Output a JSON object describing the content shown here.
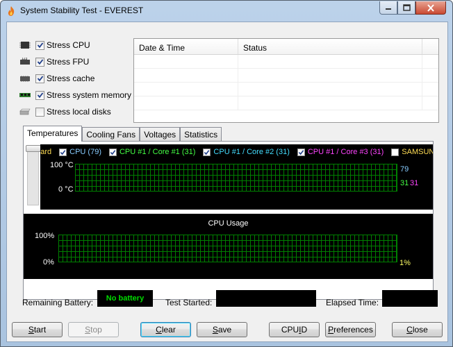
{
  "window": {
    "title": "System Stability Test - EVEREST",
    "min_glyph": "—",
    "max_glyph": "☐",
    "close_glyph": "✕"
  },
  "stress": [
    {
      "label": "Stress CPU",
      "checked": true,
      "icon": "cpu-chip-icon"
    },
    {
      "label": "Stress FPU",
      "checked": true,
      "icon": "fpu-chip-icon"
    },
    {
      "label": "Stress cache",
      "checked": true,
      "icon": "cache-chip-icon"
    },
    {
      "label": "Stress system memory",
      "checked": true,
      "icon": "memory-module-icon"
    },
    {
      "label": "Stress local disks",
      "checked": false,
      "icon": "hard-disk-icon"
    }
  ],
  "log": {
    "columns": [
      "Date & Time",
      "Status"
    ],
    "rows": []
  },
  "tabs": [
    "Temperatures",
    "Cooling Fans",
    "Voltages",
    "Statistics"
  ],
  "active_tab": 0,
  "temperature_graph": {
    "legend": [
      {
        "label": "board",
        "checked": null,
        "color": "#ffdd55"
      },
      {
        "label": "CPU (79)",
        "checked": true,
        "color": "#88ccff"
      },
      {
        "label": "CPU #1 / Core #1 (31)",
        "checked": true,
        "color": "#44ff44"
      },
      {
        "label": "CPU #1 / Core #2 (31)",
        "checked": true,
        "color": "#44ddff"
      },
      {
        "label": "CPU #1 / Core #3 (31)",
        "checked": true,
        "color": "#ff44ff"
      },
      {
        "label": "SAMSUNG",
        "checked": false,
        "color": "#ffdd55"
      }
    ],
    "y_top": "100 °C",
    "y_bottom": "0 °C",
    "readings": {
      "cpu": "79",
      "core1": "31",
      "core3": "31"
    },
    "grid_color": "#008000"
  },
  "cpu_usage": {
    "title": "CPU Usage",
    "y_top": "100%",
    "y_bottom": "0%",
    "reading": "1%",
    "reading_color": "#ffff66",
    "grid_color": "#008000"
  },
  "status": {
    "battery_label": "Remaining Battery:",
    "battery_value": "No battery",
    "started_label": "Test Started:",
    "started_value": "",
    "elapsed_label": "Elapsed Time:",
    "elapsed_value": ""
  },
  "buttons": {
    "start": {
      "prefix": "",
      "accel": "S",
      "rest": "tart"
    },
    "stop": {
      "prefix": "",
      "accel": "S",
      "rest": "top"
    },
    "clear": {
      "prefix": "",
      "accel": "C",
      "rest": "lear"
    },
    "save": {
      "prefix": "",
      "accel": "S",
      "rest": "ave"
    },
    "cpuid": {
      "prefix": "CPU",
      "accel": "I",
      "rest": "D"
    },
    "preferences": {
      "prefix": "",
      "accel": "P",
      "rest": "references"
    },
    "close": {
      "prefix": "",
      "accel": "C",
      "rest": "lose"
    }
  }
}
